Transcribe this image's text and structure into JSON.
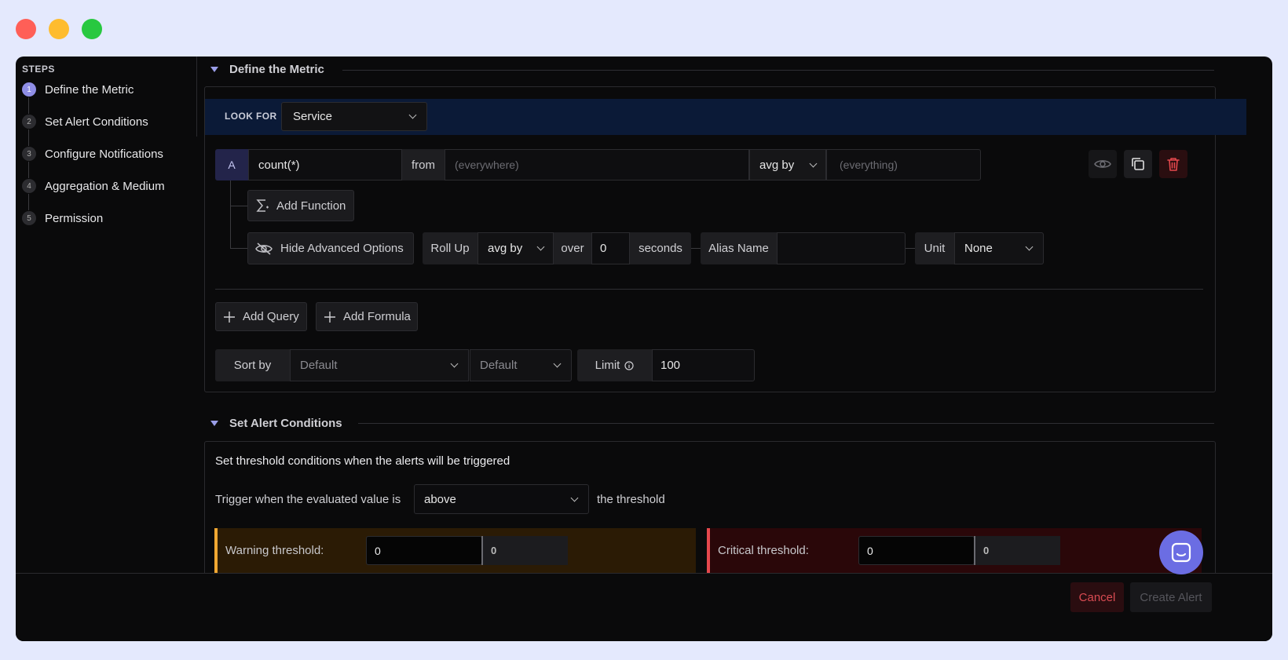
{
  "sidebar": {
    "title": "STEPS",
    "steps": [
      {
        "num": "1",
        "label": "Define the Metric"
      },
      {
        "num": "2",
        "label": "Set Alert Conditions"
      },
      {
        "num": "3",
        "label": "Configure Notifications"
      },
      {
        "num": "4",
        "label": "Aggregation & Medium"
      },
      {
        "num": "5",
        "label": "Permission"
      }
    ],
    "active_step": 1
  },
  "metric": {
    "section_title": "Define the Metric",
    "look_for_label": "LOOK FOR",
    "look_for_value": "Service",
    "query": {
      "tag": "A",
      "expression": "count(*)",
      "from_label": "from",
      "from_placeholder": "(everywhere)",
      "group_op": "avg by",
      "group_placeholder": "(everything)"
    },
    "add_function_label": "Add Function",
    "advanced": {
      "toggle_label": "Hide Advanced Options",
      "rollup_label": "Roll Up",
      "rollup_value": "avg by",
      "over_label": "over",
      "over_value": "0",
      "seconds_label": "seconds",
      "alias_label": "Alias Name",
      "alias_value": "",
      "unit_label": "Unit",
      "unit_value": "None"
    },
    "add_query_label": "Add Query",
    "add_formula_label": "Add Formula",
    "sort": {
      "label": "Sort by",
      "field_value": "Default",
      "order_value": "Default",
      "limit_label": "Limit",
      "limit_value": "100"
    }
  },
  "alert": {
    "section_title": "Set Alert Conditions",
    "description": "Set threshold conditions when the alerts will be triggered",
    "trigger_prefix": "Trigger when the evaluated value is",
    "trigger_value": "above",
    "trigger_suffix": "the threshold",
    "warning": {
      "label": "Warning threshold:",
      "value": "0",
      "secondary": "0",
      "color": "#f0a732"
    },
    "critical": {
      "label": "Critical threshold:",
      "value": "0",
      "secondary": "0",
      "color": "#e5484d"
    }
  },
  "footer": {
    "cancel_label": "Cancel",
    "create_label": "Create Alert"
  },
  "colors": {
    "accent": "#8f8ee6",
    "look_for_bg": "#0b1a37",
    "chat": "#6b6de3"
  }
}
